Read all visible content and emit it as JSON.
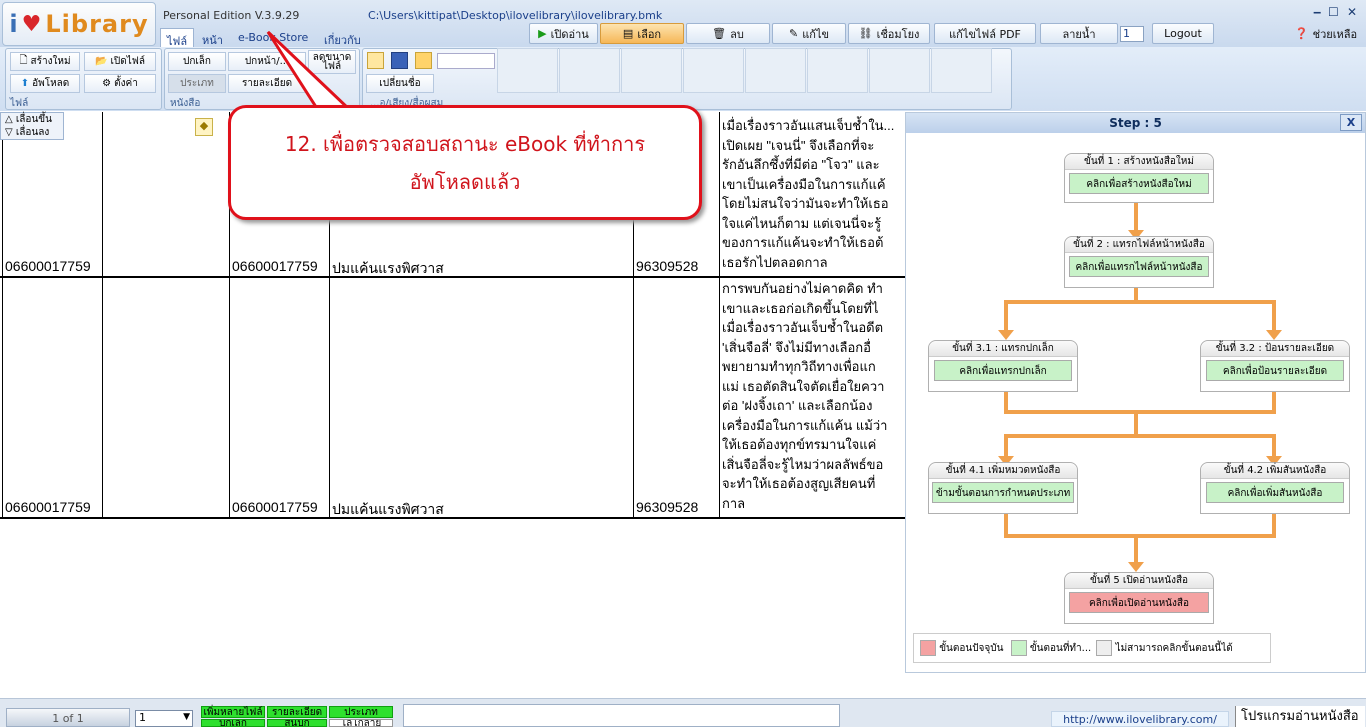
{
  "app": {
    "logo_i": "i",
    "logo_heart": "♥",
    "logo_text": "Library",
    "edition": "Personal Edition V.3.9.29",
    "file_path": "C:\\Users\\kittipat\\Desktop\\ilovelibrary\\ilovelibrary.bmk",
    "window_buttons": [
      "‒",
      "☐",
      "✕"
    ]
  },
  "tabs": [
    "ไฟล์",
    "หน้า",
    "e-Book Store",
    "เกี่ยวกับ"
  ],
  "toolbar": {
    "open_read": "เปิดอ่าน",
    "select": "เลือก",
    "delete": "ลบ",
    "edit": "แก้ไข",
    "link": "เชื่อมโยง",
    "edit_pdf": "แก้ไขไฟล์ PDF",
    "watermark": "ลายน้ำ",
    "watermark_value": "1",
    "logout": "Logout",
    "help": "ช่วยเหลือ"
  },
  "ribbon": {
    "file_group": {
      "new": "สร้างใหม่",
      "open_file": "เปิดไฟล์",
      "upload": "อัพโหลด",
      "settings": "ตั้งค่า",
      "label": "ไฟล์"
    },
    "book_group": {
      "small_cover": "ปกเล็ก",
      "big_cover": "ปกหน้า/...",
      "reduce": "ลดขนาดไฟล์",
      "category": "ประเภท",
      "details": "รายละเอียด",
      "label": "หนังสือ"
    },
    "media_group": {
      "rename": "เปลี่ยนชื่อ",
      "label": "...อ/เสียง/สื่อผสม"
    }
  },
  "nav": {
    "up": "เลื่อนขึ้น",
    "down": "เลื่อนลง"
  },
  "table": {
    "rows": [
      {
        "col1": "06600017759",
        "col2": "06600017759",
        "title": "ปมแค้นแรงพิศวาส",
        "code": "96309528",
        "synopsis": [
          "เมื่อเรื่องราวอันแสนเจ็บช้ำใน...",
          "เปิดเผย \"เจนนี่\" จึงเลือกที่จะ",
          "รักอันลึกซึ้งที่มีต่อ \"โจว\" และ",
          "เขาเป็นเครื่องมือในการแก้แค้",
          "โดยไม่สนใจว่ามันจะทำให้เธอ",
          "ใจแค่ไหนก็ตาม แต่เจนนี่จะรู้",
          "ของการแก้แค้นจะทำให้เธอต้",
          "เธอรักไปตลอดกาล"
        ]
      },
      {
        "col1": "06600017759",
        "col2": "06600017759",
        "title": "ปมแค้นแรงพิศวาส",
        "code": "96309528",
        "synopsis": [
          "การพบกันอย่างไม่คาดคิด ทำ",
          "เขาและเธอก่อเกิดขึ้นโดยที่ไ",
          "เมื่อเรื่องราวอันเจ็บช้ำในอดีต",
          "'เสิ่นจือลี่' จึงไม่มีทางเลือกอื่",
          "พยายามทำทุกวิถีทางเพื่อแก",
          "แม่ เธอตัดสินใจตัดเยื่อใยควา",
          "ต่อ 'ฝงจิ้งเถา' และเลือกน้อง",
          "เครื่องมือในการแก้แค้น แม้ว่า",
          "ให้เธอต้องทุกข์ทรมานใจแค่",
          "เสิ่นจือลี่จะรู้ไหมว่าผลลัพธ์ขอ",
          "จะทำให้เธอต้องสูญเสียคนที่",
          "กาล"
        ]
      }
    ]
  },
  "callout": {
    "line1": "12. เพื่อตรวจสอบสถานะ eBook ที่ทำการ",
    "line2": "อัพโหลดแล้ว"
  },
  "step_window": {
    "title": "Step : 5",
    "close": "X",
    "step1_title": "ขั้นที่ 1 : สร้างหนังสือใหม่",
    "step1_btn": "คลิกเพื่อสร้างหนังสือใหม่",
    "step2_title": "ขั้นที่ 2 : แทรกไฟล์หน้าหนังสือ",
    "step2_btn": "คลิกเพื่อแทรกไฟล์หน้าหนังสือ",
    "step31_title": "ขั้นที่ 3.1 : แทรกปกเล็ก",
    "step31_btn": "คลิกเพื่อแทรกปกเล็ก",
    "step32_title": "ขั้นที่ 3.2 : ป้อนรายละเอียด",
    "step32_btn": "คลิกเพื่อป้อนรายละเอียด",
    "step41_title": "ขั้นที่ 4.1 เพิ่มหมวดหนังสือ",
    "step41_btn": "ข้ามขั้นตอนการกำหนดประเภท",
    "step42_title": "ขั้นที่ 4.2 เพิ่มสันหนังสือ",
    "step42_btn": "คลิกเพื่อเพิ่มสันหนังสือ",
    "step5_title": "ขั้นที่ 5 เปิดอ่านหนังสือ",
    "step5_btn": "คลิกเพื่อเปิดอ่านหนังสือ",
    "legend_current": "ขั้นตอนปัจจุบัน",
    "legend_done": "ขั้นตอนที่ทำ...",
    "legend_disabled": "ไม่สามารถคลิกขั้นตอนนี้ได้",
    "colors": {
      "current": "#f4a2a2",
      "done": "#c8f2c8",
      "disabled": "#eeeeee",
      "connector": "#f0a04b"
    }
  },
  "bottom": {
    "page": "1 of 1",
    "page_select": "1",
    "btn_add_many": "เพิ่มหลายไฟล์",
    "btn_details": "รายละเอียด",
    "btn_category": "ประเภท",
    "btn_small_cover": "ปกเล็ก",
    "btn_spine": "สันปก",
    "btn_logo": "โลโก้ลาย",
    "url": "http://www.ilovelibrary.com/",
    "reader": "โปรแกรมอ่านหนังสือ"
  }
}
